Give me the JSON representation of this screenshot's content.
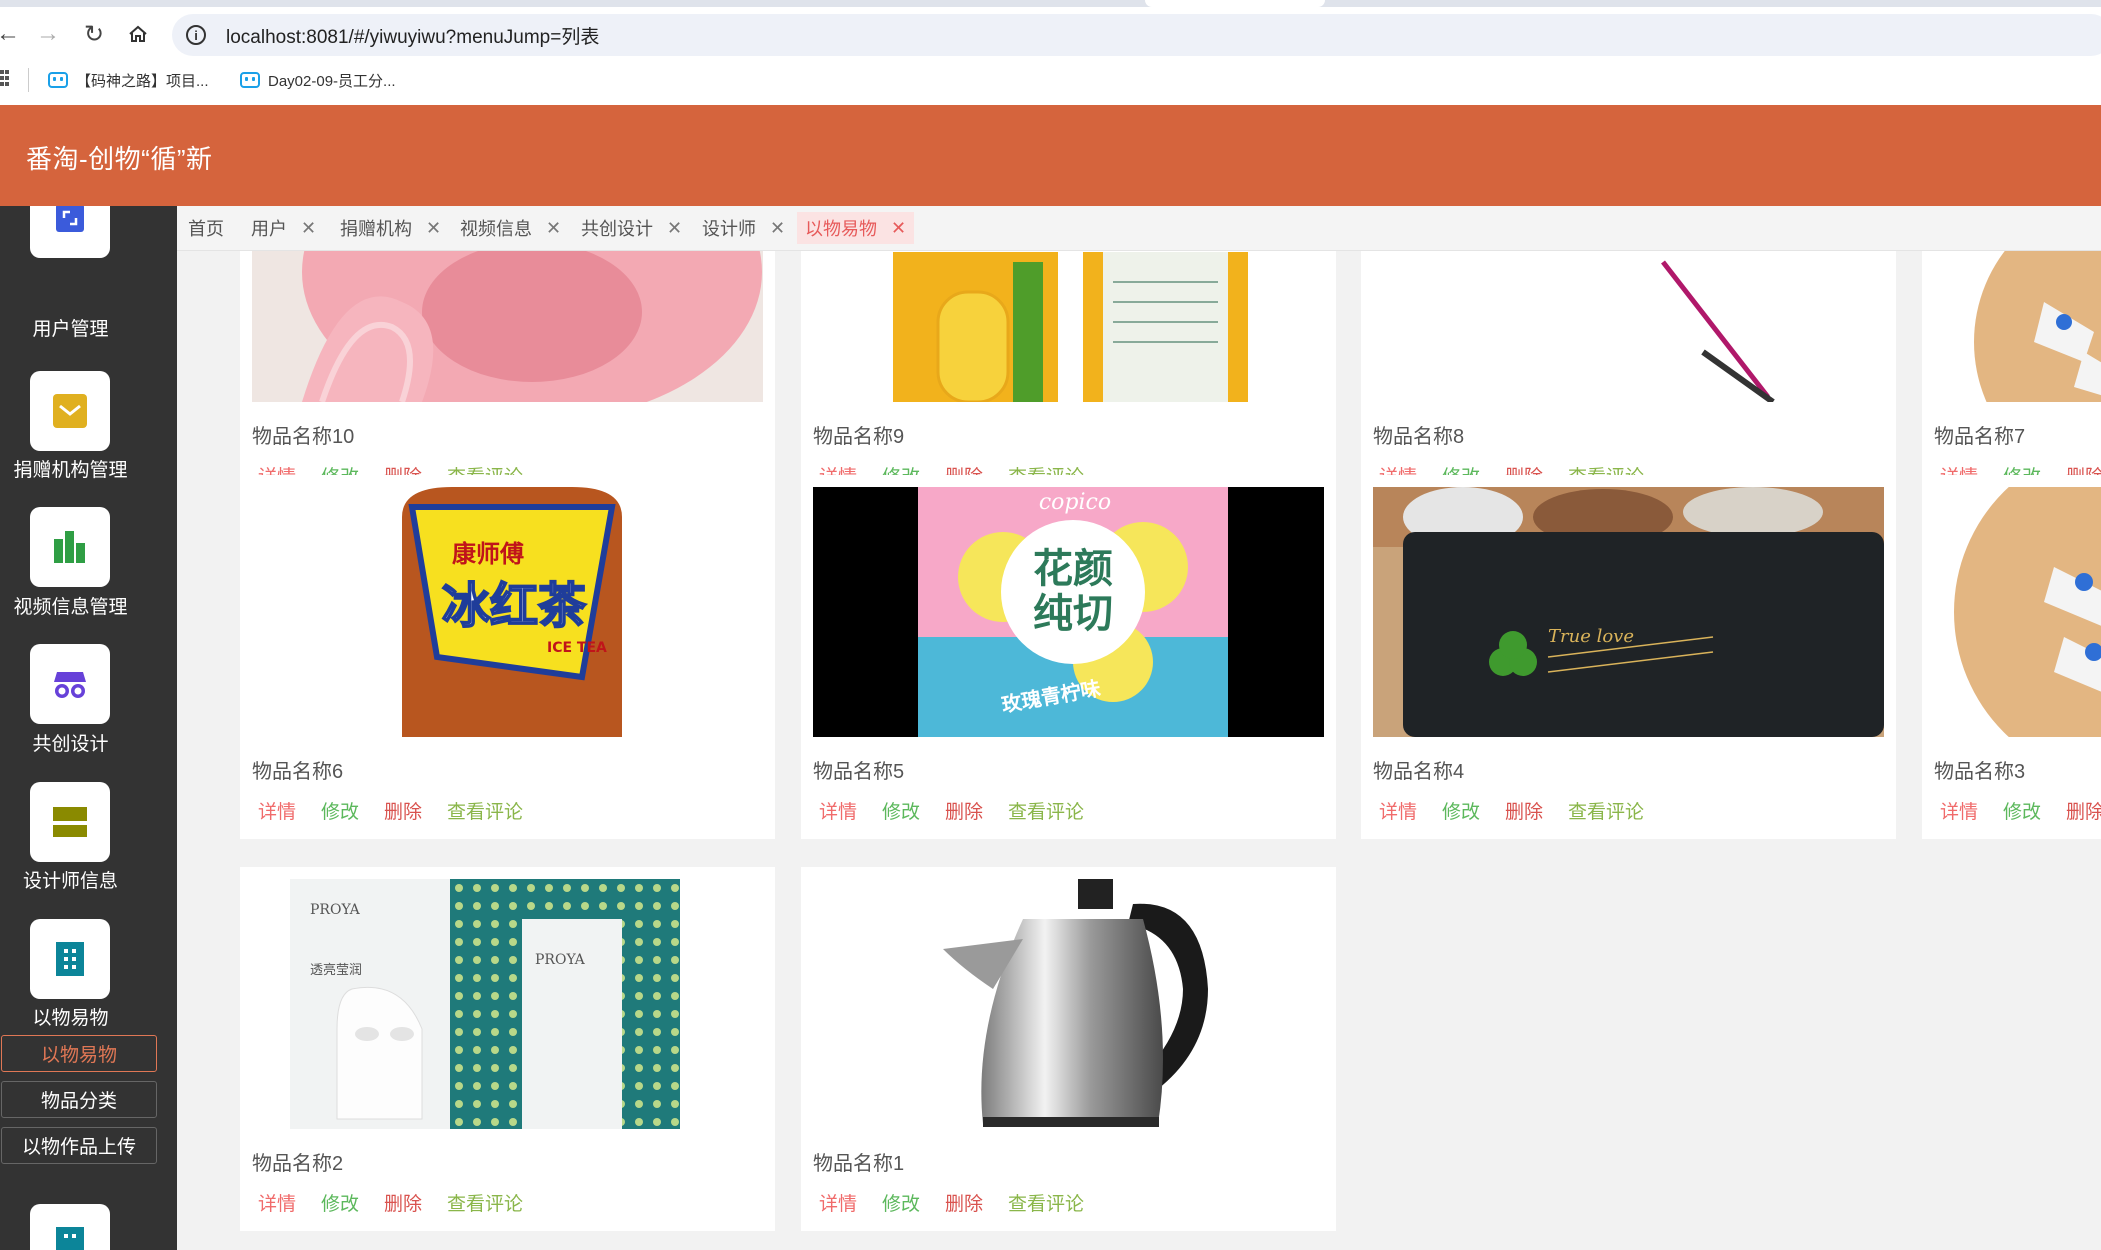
{
  "browser": {
    "url": "localhost:8081/#/yiwuyiwu?menuJump=列表",
    "bookmarks": [
      "【码神之路】项目...",
      "Day02-09-员工分..."
    ]
  },
  "app": {
    "title": "番淘-创物“循”新"
  },
  "sidebar": {
    "items": [
      {
        "label": "用户管理",
        "icon": "user-manage-icon",
        "color": "#3b5bdb"
      },
      {
        "label": "捐赠机构管理",
        "icon": "envelope-icon",
        "color": "#e0b020"
      },
      {
        "label": "视频信息管理",
        "icon": "bar-chart-icon",
        "color": "#2f9e44"
      },
      {
        "label": "共创设计",
        "icon": "incognito-icon",
        "color": "#6741d9"
      },
      {
        "label": "设计师信息",
        "icon": "panel-icon",
        "color": "#8a8a00"
      },
      {
        "label": "以物易物",
        "icon": "building-icon",
        "color": "#0c8599"
      }
    ],
    "subitems": [
      "以物易物",
      "物品分类",
      "以物作品上传"
    ],
    "active_subitem": "以物易物"
  },
  "tags": [
    {
      "label": "首页",
      "closable": false
    },
    {
      "label": "用户",
      "closable": true
    },
    {
      "label": "捐赠机构",
      "closable": true
    },
    {
      "label": "视频信息",
      "closable": true
    },
    {
      "label": "共创设计",
      "closable": true
    },
    {
      "label": "设计师",
      "closable": true
    },
    {
      "label": "以物易物",
      "closable": true,
      "active": true
    }
  ],
  "actions": {
    "detail": "详情",
    "edit": "修改",
    "delete": "删除",
    "comments": "查看评论"
  },
  "items": [
    {
      "name": "物品名称10"
    },
    {
      "name": "物品名称9"
    },
    {
      "name": "物品名称8"
    },
    {
      "name": "物品名称7"
    },
    {
      "name": "物品名称6"
    },
    {
      "name": "物品名称5"
    },
    {
      "name": "物品名称4"
    },
    {
      "name": "物品名称3"
    },
    {
      "name": "物品名称2"
    },
    {
      "name": "物品名称1"
    }
  ],
  "product_image_text": {
    "tea_brand": "康师傅",
    "tea_name": "冰红茶",
    "tea_sub": "ICE TEA",
    "chips_brand": "copico",
    "chips_name_1": "花颜",
    "chips_name_2": "纯切",
    "chips_flavor": "玫瑰青柠味",
    "mat_text": "True love",
    "mask_brand": "PROYA",
    "mask_name": "透亮莹润"
  }
}
